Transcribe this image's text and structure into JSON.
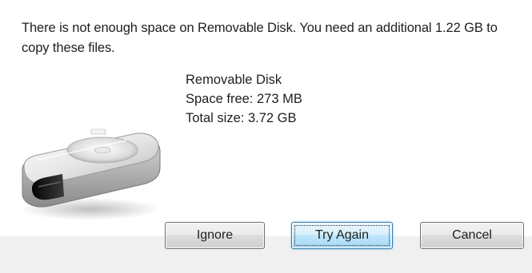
{
  "dialog": {
    "message": "There is not enough space on Removable Disk. You need an additional 1.22 GB to copy these files.",
    "drive": {
      "name": "Removable Disk",
      "space_free": "Space free: 273 MB",
      "total_size": "Total size: 3.72 GB",
      "icon": "removable-drive-icon"
    }
  },
  "buttons": {
    "ignore_label": "Ignore",
    "try_again_label": "Try Again",
    "cancel_label": "Cancel"
  },
  "colors": {
    "focused_button_border": "#3c7fb1",
    "footer_background": "#f0f0f0"
  }
}
